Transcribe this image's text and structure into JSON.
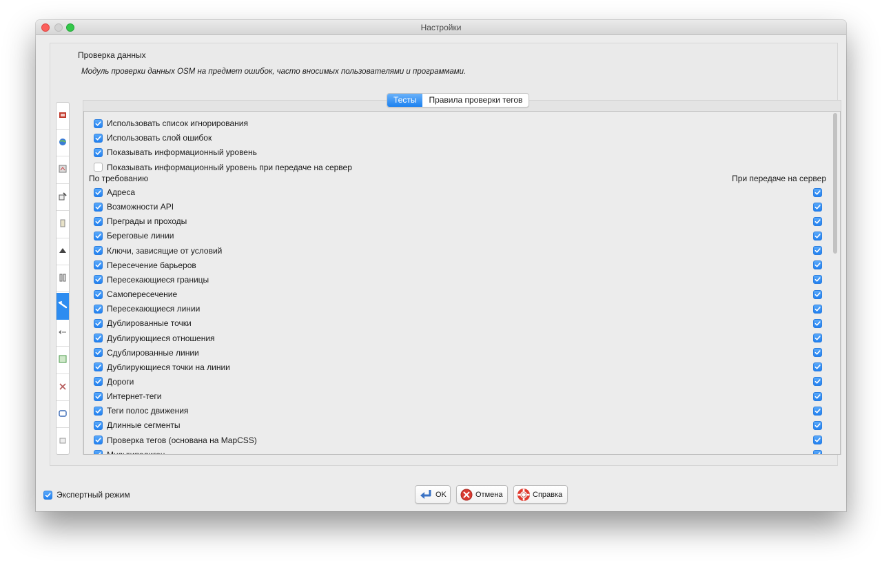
{
  "window": {
    "title": "Настройки"
  },
  "sidebar": {
    "icons": [
      {
        "name": "display-settings-icon",
        "color": "#c0392b"
      },
      {
        "name": "connection-globe-icon",
        "color": "#3a7bd5"
      },
      {
        "name": "map-settings-icon",
        "color": "#7a7a7a"
      },
      {
        "name": "map-paint-icon",
        "color": "#5b5b5b"
      },
      {
        "name": "presets-icon",
        "color": "#8a8a8a"
      },
      {
        "name": "plugins-icon",
        "color": "#444444"
      },
      {
        "name": "shortcuts-icon",
        "color": "#6a6a6a"
      },
      {
        "name": "validator-icon",
        "color": "#ffffff",
        "active": true
      },
      {
        "name": "audio-icon",
        "color": "#6a6a6a"
      },
      {
        "name": "remote-control-icon",
        "color": "#4a9a4a"
      },
      {
        "name": "imagery-icon",
        "color": "#b55a5a"
      },
      {
        "name": "projection-icon",
        "color": "#3a6ab5"
      },
      {
        "name": "advanced-icon",
        "color": "#9a9a9a"
      }
    ]
  },
  "section": {
    "title": "Проверка данных",
    "description": "Модуль проверки данных OSM на предмет ошибок, часто вносимых пользователями и программами."
  },
  "tabs": [
    {
      "label": "Тесты",
      "active": true
    },
    {
      "label": "Правила проверки тегов",
      "active": false
    }
  ],
  "options": [
    {
      "label": "Использовать список игнорирования",
      "checked": true
    },
    {
      "label": "Использовать слой ошибок",
      "checked": true
    },
    {
      "label": "Показывать информационный уровень",
      "checked": true
    },
    {
      "label": "Показывать информационный уровень при передаче на сервер",
      "checked": false
    }
  ],
  "columns": {
    "on_demand": "По требованию",
    "on_upload": "При передаче на сервер"
  },
  "tests": [
    {
      "label": "Адреса",
      "on_demand": true,
      "on_upload": true
    },
    {
      "label": "Возможности API",
      "on_demand": true,
      "on_upload": true
    },
    {
      "label": "Преграды и проходы",
      "on_demand": true,
      "on_upload": true
    },
    {
      "label": "Береговые линии",
      "on_demand": true,
      "on_upload": true
    },
    {
      "label": "Ключи, зависящие от условий",
      "on_demand": true,
      "on_upload": true
    },
    {
      "label": "Пересечение барьеров",
      "on_demand": true,
      "on_upload": true
    },
    {
      "label": "Пересекающиеся границы",
      "on_demand": true,
      "on_upload": true
    },
    {
      "label": "Самопересечение",
      "on_demand": true,
      "on_upload": true
    },
    {
      "label": "Пересекающиеся линии",
      "on_demand": true,
      "on_upload": true
    },
    {
      "label": "Дублированные точки",
      "on_demand": true,
      "on_upload": true
    },
    {
      "label": "Дублирующиеся отношения",
      "on_demand": true,
      "on_upload": true
    },
    {
      "label": "Сдублированные линии",
      "on_demand": true,
      "on_upload": true
    },
    {
      "label": "Дублирующиеся точки на линии",
      "on_demand": true,
      "on_upload": true
    },
    {
      "label": "Дороги",
      "on_demand": true,
      "on_upload": true
    },
    {
      "label": "Интернет-теги",
      "on_demand": true,
      "on_upload": true
    },
    {
      "label": "Теги полос движения",
      "on_demand": true,
      "on_upload": true
    },
    {
      "label": "Длинные сегменты",
      "on_demand": true,
      "on_upload": true
    },
    {
      "label": "Проверка тегов (основана на MapCSS)",
      "on_demand": true,
      "on_upload": true
    },
    {
      "label": "Мультиполигон",
      "on_demand": true,
      "on_upload": true
    }
  ],
  "footer": {
    "expert_mode": {
      "label": "Экспертный режим",
      "checked": true
    },
    "ok_label": "OK",
    "cancel_label": "Отмена",
    "help_label": "Справка"
  },
  "colors": {
    "accent": "#2180f0",
    "window_bg": "#ececec"
  }
}
